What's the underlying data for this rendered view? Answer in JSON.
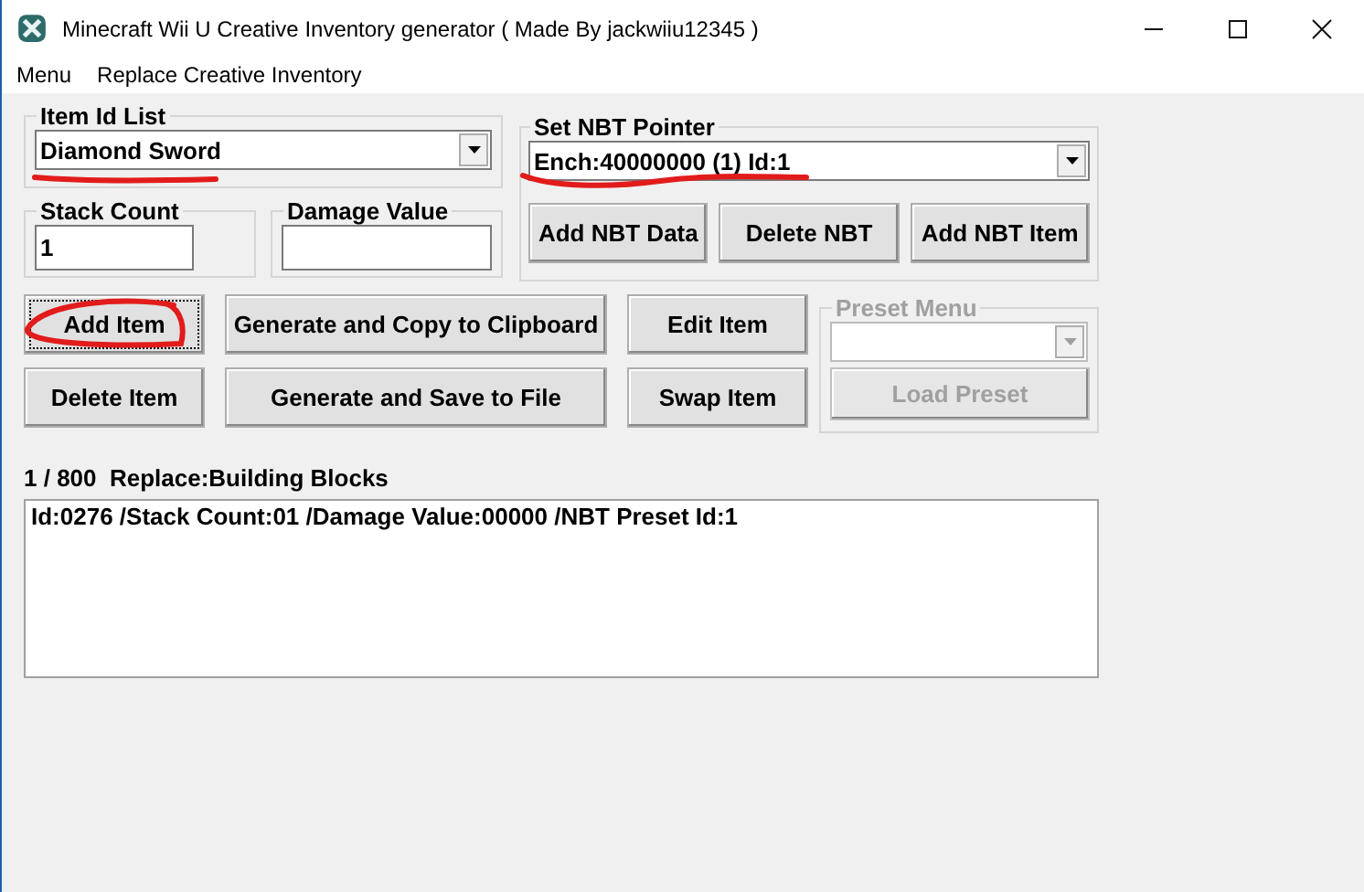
{
  "window": {
    "title": "Minecraft Wii U Creative Inventory generator ( Made By jackwiiu12345 )"
  },
  "menu": [
    "Menu",
    "Replace Creative Inventory"
  ],
  "item_id_list": {
    "label": "Item Id List",
    "value": "Diamond Sword"
  },
  "stack_count": {
    "label": "Stack Count",
    "value": "1"
  },
  "damage_value": {
    "label": "Damage Value"
  },
  "nbt_pointer": {
    "label": "Set NBT Pointer",
    "value": "Ench:40000000 (1) Id:1",
    "buttons": [
      "Add NBT Data",
      "Delete NBT",
      "Add NBT Item"
    ]
  },
  "buttons": [
    {
      "label": "Add Item",
      "focused": true
    },
    {
      "label": "Generate and Copy to Clipboard",
      "focused": false
    },
    {
      "label": "Edit Item",
      "focused": false
    },
    {
      "label": "Delete Item",
      "focused": false
    },
    {
      "label": "Generate and Save to File",
      "focused": false
    },
    {
      "label": "Swap Item",
      "focused": false
    }
  ],
  "preset_menu": {
    "label": "Preset Menu",
    "disabled": true,
    "button": "Load Preset"
  },
  "status": "1 / 800  Replace:Building Blocks",
  "items": [
    "Id:0276 /Stack Count:01 /Damage Value:00000 /NBT Preset Id:1"
  ]
}
